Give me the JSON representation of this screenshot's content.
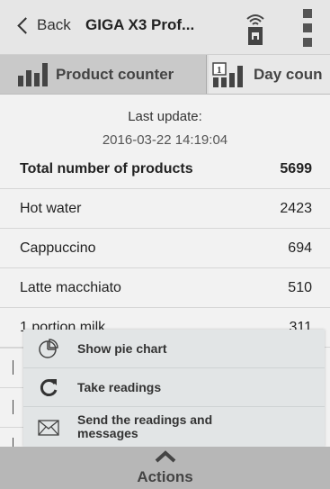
{
  "header": {
    "back_label": "Back",
    "title": "GIGA X3 Prof...",
    "machine_icon": "coffee-machine-wifi-icon",
    "menu_icon": "kebab-menu-icon"
  },
  "tabs": [
    {
      "label": "Product counter",
      "icon": "bar-chart-icon",
      "active": true
    },
    {
      "label": "Day coun",
      "icon": "calendar-bar-icon",
      "active": false
    }
  ],
  "update": {
    "label": "Last update:",
    "timestamp": "2016-03-22 14:19:04"
  },
  "counters": [
    {
      "name": "Total number of products",
      "value": "5699"
    },
    {
      "name": "Hot water",
      "value": "2423"
    },
    {
      "name": "Cappuccino",
      "value": "694"
    },
    {
      "name": "Latte macchiato",
      "value": "510"
    },
    {
      "name": "1 portion milk",
      "value": "311"
    }
  ],
  "actions_menu": [
    {
      "label": "Show pie chart",
      "icon": "pie-chart-icon"
    },
    {
      "label": "Take readings",
      "icon": "refresh-icon"
    },
    {
      "label": "Send the readings and messages",
      "icon": "envelope-icon"
    }
  ],
  "actions_bar": {
    "label": "Actions",
    "icon": "chevron-up-icon"
  },
  "colors": {
    "header_bg": "#e6e6e6",
    "tab_active_bg": "#c9c9c9",
    "actions_bg": "#b7b7b7",
    "popup_bg": "#e2e5e6"
  }
}
